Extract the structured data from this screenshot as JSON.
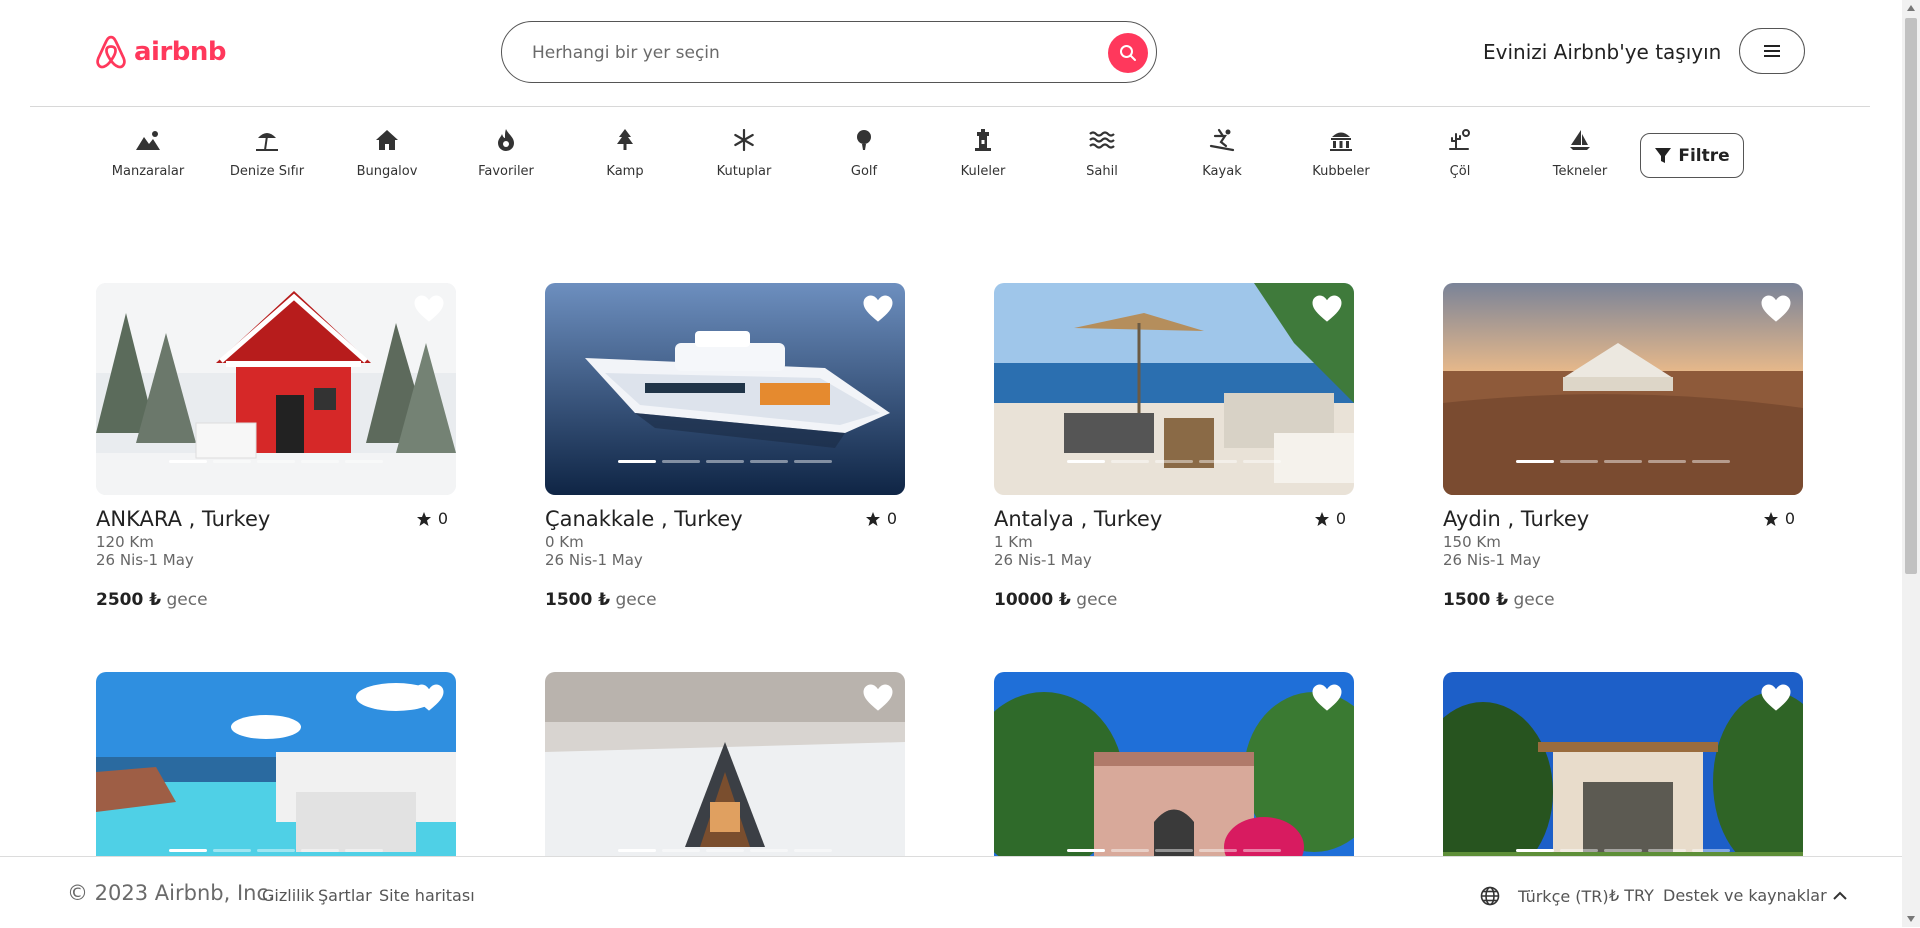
{
  "header": {
    "logo_text": "airbnb",
    "search_placeholder": "Herhangi bir yer seçin",
    "host_link": "Evinizi Airbnb'ye taşıyın"
  },
  "categories": [
    {
      "label": "Manzaralar",
      "icon": "mountain-icon"
    },
    {
      "label": "Denize Sıfır",
      "icon": "beach-umbrella-icon"
    },
    {
      "label": "Bungalov",
      "icon": "house-icon"
    },
    {
      "label": "Favoriler",
      "icon": "fire-icon"
    },
    {
      "label": "Kamp",
      "icon": "tree-icon"
    },
    {
      "label": "Kutuplar",
      "icon": "snowflake-icon"
    },
    {
      "label": "Golf",
      "icon": "golf-icon"
    },
    {
      "label": "Kuleler",
      "icon": "tower-icon"
    },
    {
      "label": "Sahil",
      "icon": "waves-icon"
    },
    {
      "label": "Kayak",
      "icon": "skiing-icon"
    },
    {
      "label": "Kubbeler",
      "icon": "dome-icon"
    },
    {
      "label": "Çöl",
      "icon": "desert-icon"
    },
    {
      "label": "Tekneler",
      "icon": "sailboat-icon"
    }
  ],
  "filter_label": "Filtre",
  "listings": [
    {
      "title": "ANKARA , Turkey",
      "rating": "0",
      "distance": "120 Km",
      "dates": "26 Nis-1 May",
      "price": "2500 ₺",
      "price_unit": "gece",
      "image": "red-cabin-snow-photo"
    },
    {
      "title": "Çanakkale , Turkey",
      "rating": "0",
      "distance": "0 Km",
      "dates": "26 Nis-1 May",
      "price": "1500 ₺",
      "price_unit": "gece",
      "image": "yacht-photo"
    },
    {
      "title": "Antalya , Turkey",
      "rating": "0",
      "distance": "1 Km",
      "dates": "26 Nis-1 May",
      "price": "10000 ₺",
      "price_unit": "gece",
      "image": "seaside-terrace-photo"
    },
    {
      "title": "Aydin , Turkey",
      "rating": "0",
      "distance": "150 Km",
      "dates": "26 Nis-1 May",
      "price": "1500 ₺",
      "price_unit": "gece",
      "image": "desert-tent-photo"
    },
    {
      "image": "infinity-pool-photo"
    },
    {
      "image": "a-frame-snow-photo"
    },
    {
      "image": "villa-garden-photo"
    },
    {
      "image": "pergola-house-photo"
    }
  ],
  "footer": {
    "copyright": "© 2023 Airbnb, Inc.",
    "links": [
      "Gizlilik",
      "Şartlar",
      "Site haritası"
    ],
    "language": "Türkçe (TR)",
    "currency": "₺ TRY",
    "support": "Destek ve kaynaklar"
  },
  "colors": {
    "brand": "#ff385c",
    "text": "#222222",
    "muted": "#6a6a6a"
  }
}
